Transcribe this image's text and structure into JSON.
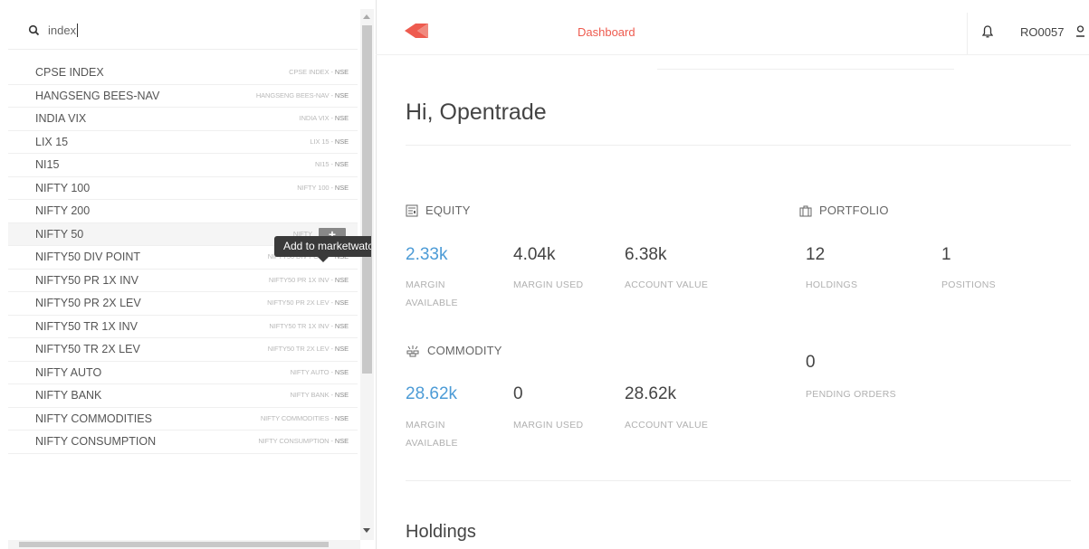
{
  "search": {
    "value": "index"
  },
  "instruments": [
    {
      "name": "CPSE INDEX",
      "symbol": "CPSE INDEX",
      "exchange": "NSE"
    },
    {
      "name": "HANGSENG BEES-NAV",
      "symbol": "HANGSENG BEES-NAV",
      "exchange": "NSE"
    },
    {
      "name": "INDIA VIX",
      "symbol": "INDIA VIX",
      "exchange": "NSE"
    },
    {
      "name": "LIX 15",
      "symbol": "LIX 15",
      "exchange": "NSE"
    },
    {
      "name": "NI15",
      "symbol": "NI15",
      "exchange": "NSE"
    },
    {
      "name": "NIFTY 100",
      "symbol": "NIFTY 100",
      "exchange": "NSE"
    },
    {
      "name": "NIFTY 200",
      "symbol": "",
      "exchange": ""
    },
    {
      "name": "NIFTY 50",
      "symbol": "NIFTY",
      "exchange": ""
    },
    {
      "name": "NIFTY50 DIV POINT",
      "symbol": "NIFTY50 DIV POINT",
      "exchange": "NSE"
    },
    {
      "name": "NIFTY50 PR 1X INV",
      "symbol": "NIFTY50 PR 1X INV",
      "exchange": "NSE"
    },
    {
      "name": "NIFTY50 PR 2X LEV",
      "symbol": "NIFTY50 PR 2X LEV",
      "exchange": "NSE"
    },
    {
      "name": "NIFTY50 TR 1X INV",
      "symbol": "NIFTY50 TR 1X INV",
      "exchange": "NSE"
    },
    {
      "name": "NIFTY50 TR 2X LEV",
      "symbol": "NIFTY50 TR 2X LEV",
      "exchange": "NSE"
    },
    {
      "name": "NIFTY AUTO",
      "symbol": "NIFTY AUTO",
      "exchange": "NSE"
    },
    {
      "name": "NIFTY BANK",
      "symbol": "NIFTY BANK",
      "exchange": "NSE"
    },
    {
      "name": "NIFTY COMMODITIES",
      "symbol": "NIFTY COMMODITIES",
      "exchange": "NSE"
    },
    {
      "name": "NIFTY CONSUMPTION",
      "symbol": "NIFTY CONSUMPTION",
      "exchange": "NSE"
    }
  ],
  "tooltip": {
    "text": "Add to marketwatch"
  },
  "add_button": {
    "label": "+"
  },
  "header": {
    "nav_dashboard": "Dashboard",
    "user_id": "RO0057"
  },
  "greeting": "Hi, Opentrade",
  "equity": {
    "title": "EQUITY",
    "margin_available": "2.33k",
    "margin_available_label": "MARGIN AVAILABLE",
    "margin_used": "4.04k",
    "margin_used_label": "MARGIN USED",
    "account_value": "6.38k",
    "account_value_label": "ACCOUNT VALUE"
  },
  "portfolio": {
    "title": "PORTFOLIO",
    "holdings": "12",
    "holdings_label": "HOLDINGS",
    "positions": "1",
    "positions_label": "POSITIONS",
    "pending_orders": "0",
    "pending_orders_label": "PENDING ORDERS"
  },
  "commodity": {
    "title": "COMMODITY",
    "margin_available": "28.62k",
    "margin_available_label": "MARGIN AVAILABLE",
    "margin_used": "0",
    "margin_used_label": "MARGIN USED",
    "account_value": "28.62k",
    "account_value_label": "ACCOUNT VALUE"
  },
  "holdings_title": "Holdings",
  "colors": {
    "accent": "#ee5b4f",
    "link_blue": "#4c9bd6"
  }
}
